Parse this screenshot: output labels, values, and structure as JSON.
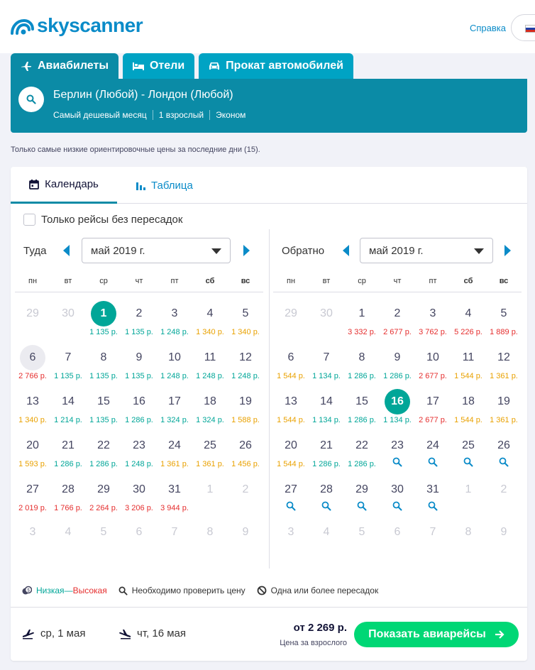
{
  "header": {
    "logo_text": "skyscanner",
    "help_label": "Справка",
    "language": "ru"
  },
  "tabs": [
    {
      "label": "Авиабилеты",
      "icon": "plane-icon",
      "active": true
    },
    {
      "label": "Отели",
      "icon": "bed-icon",
      "active": false
    },
    {
      "label": "Прокат автомобилей",
      "icon": "car-icon",
      "active": false
    }
  ],
  "search": {
    "route": "Берлин (Любой) - Лондон (Любой)",
    "period": "Самый дешевый месяц",
    "passengers": "1 взрослый",
    "cabin": "Эконом"
  },
  "note": "Только самые низкие ориентировочные цены за последние дни (15).",
  "view_tabs": {
    "calendar": "Календарь",
    "table": "Таблица"
  },
  "direct_only": "Только рейсы без пересадок",
  "outbound": {
    "label": "Туда",
    "month": "май 2019 г.",
    "weekdays": [
      "пн",
      "вт",
      "ср",
      "чт",
      "пт",
      "сб",
      "вс"
    ],
    "weeks": [
      [
        {
          "d": "29",
          "m": true
        },
        {
          "d": "30",
          "m": true
        },
        {
          "d": "1",
          "p": "1 135 р.",
          "c": "low",
          "sel": true
        },
        {
          "d": "2",
          "p": "1 135 р.",
          "c": "low"
        },
        {
          "d": "3",
          "p": "1 248 р.",
          "c": "low"
        },
        {
          "d": "4",
          "p": "1 340 р.",
          "c": "mid"
        },
        {
          "d": "5",
          "p": "1 340 р.",
          "c": "mid"
        }
      ],
      [
        {
          "d": "6",
          "p": "2 766 р.",
          "c": "high",
          "today": true
        },
        {
          "d": "7",
          "p": "1 135 р.",
          "c": "low"
        },
        {
          "d": "8",
          "p": "1 135 р.",
          "c": "low"
        },
        {
          "d": "9",
          "p": "1 135 р.",
          "c": "low"
        },
        {
          "d": "10",
          "p": "1 248 р.",
          "c": "low"
        },
        {
          "d": "11",
          "p": "1 248 р.",
          "c": "low"
        },
        {
          "d": "12",
          "p": "1 248 р.",
          "c": "low"
        }
      ],
      [
        {
          "d": "13",
          "p": "1 340 р.",
          "c": "mid"
        },
        {
          "d": "14",
          "p": "1 214 р.",
          "c": "low"
        },
        {
          "d": "15",
          "p": "1 135 р.",
          "c": "low"
        },
        {
          "d": "16",
          "p": "1 286 р.",
          "c": "low"
        },
        {
          "d": "17",
          "p": "1 324 р.",
          "c": "low"
        },
        {
          "d": "18",
          "p": "1 324 р.",
          "c": "low"
        },
        {
          "d": "19",
          "p": "1 588 р.",
          "c": "mid"
        }
      ],
      [
        {
          "d": "20",
          "p": "1 593 р.",
          "c": "mid"
        },
        {
          "d": "21",
          "p": "1 286 р.",
          "c": "low"
        },
        {
          "d": "22",
          "p": "1 286 р.",
          "c": "low"
        },
        {
          "d": "23",
          "p": "1 248 р.",
          "c": "low"
        },
        {
          "d": "24",
          "p": "1 361 р.",
          "c": "mid"
        },
        {
          "d": "25",
          "p": "1 361 р.",
          "c": "mid"
        },
        {
          "d": "26",
          "p": "1 456 р.",
          "c": "mid"
        }
      ],
      [
        {
          "d": "27",
          "p": "2 019 р.",
          "c": "high"
        },
        {
          "d": "28",
          "p": "1 766 р.",
          "c": "high"
        },
        {
          "d": "29",
          "p": "2 264 р.",
          "c": "high"
        },
        {
          "d": "30",
          "p": "3 206 р.",
          "c": "high"
        },
        {
          "d": "31",
          "p": "3 944 р.",
          "c": "high"
        },
        {
          "d": "1",
          "m": true
        },
        {
          "d": "2",
          "m": true
        }
      ],
      [
        {
          "d": "3",
          "m": true
        },
        {
          "d": "4",
          "m": true
        },
        {
          "d": "5",
          "m": true
        },
        {
          "d": "6",
          "m": true
        },
        {
          "d": "7",
          "m": true
        },
        {
          "d": "8",
          "m": true
        },
        {
          "d": "9",
          "m": true
        }
      ]
    ]
  },
  "inbound": {
    "label": "Обратно",
    "month": "май 2019 г.",
    "weekdays": [
      "пн",
      "вт",
      "ср",
      "чт",
      "пт",
      "сб",
      "вс"
    ],
    "weeks": [
      [
        {
          "d": "29",
          "m": true
        },
        {
          "d": "30",
          "m": true
        },
        {
          "d": "1",
          "p": "3 332 р.",
          "c": "high"
        },
        {
          "d": "2",
          "p": "2 677 р.",
          "c": "high"
        },
        {
          "d": "3",
          "p": "3 762 р.",
          "c": "high"
        },
        {
          "d": "4",
          "p": "5 226 р.",
          "c": "high"
        },
        {
          "d": "5",
          "p": "1 889 р.",
          "c": "high"
        }
      ],
      [
        {
          "d": "6",
          "p": "1 544 р.",
          "c": "mid"
        },
        {
          "d": "7",
          "p": "1 134 р.",
          "c": "low"
        },
        {
          "d": "8",
          "p": "1 286 р.",
          "c": "low"
        },
        {
          "d": "9",
          "p": "1 286 р.",
          "c": "low"
        },
        {
          "d": "10",
          "p": "2 677 р.",
          "c": "high"
        },
        {
          "d": "11",
          "p": "1 544 р.",
          "c": "mid"
        },
        {
          "d": "12",
          "p": "1 361 р.",
          "c": "mid"
        }
      ],
      [
        {
          "d": "13",
          "p": "1 544 р.",
          "c": "mid"
        },
        {
          "d": "14",
          "p": "1 134 р.",
          "c": "low"
        },
        {
          "d": "15",
          "p": "1 286 р.",
          "c": "low"
        },
        {
          "d": "16",
          "p": "1 134 р.",
          "c": "low",
          "sel": true
        },
        {
          "d": "17",
          "p": "2 677 р.",
          "c": "high"
        },
        {
          "d": "18",
          "p": "1 544 р.",
          "c": "mid"
        },
        {
          "d": "19",
          "p": "1 361 р.",
          "c": "mid"
        }
      ],
      [
        {
          "d": "20",
          "p": "1 544 р.",
          "c": "mid"
        },
        {
          "d": "21",
          "p": "1 286 р.",
          "c": "low"
        },
        {
          "d": "22",
          "p": "1 286 р.",
          "c": "low"
        },
        {
          "d": "23",
          "s": true
        },
        {
          "d": "24",
          "s": true
        },
        {
          "d": "25",
          "s": true
        },
        {
          "d": "26",
          "s": true
        }
      ],
      [
        {
          "d": "27",
          "s": true
        },
        {
          "d": "28",
          "s": true
        },
        {
          "d": "29",
          "s": true
        },
        {
          "d": "30",
          "s": true
        },
        {
          "d": "31",
          "s": true
        },
        {
          "d": "1",
          "m": true
        },
        {
          "d": "2",
          "m": true
        }
      ],
      [
        {
          "d": "3",
          "m": true
        },
        {
          "d": "4",
          "m": true
        },
        {
          "d": "5",
          "m": true
        },
        {
          "d": "6",
          "m": true
        },
        {
          "d": "7",
          "m": true
        },
        {
          "d": "8",
          "m": true
        },
        {
          "d": "9",
          "m": true
        }
      ]
    ]
  },
  "legend": {
    "low": "Низкая",
    "dash": "—",
    "high": "Высокая",
    "check_price": "Необходимо проверить цену",
    "stops": "Одна или более пересадок"
  },
  "footer": {
    "out_date": "ср, 1 мая",
    "back_date": "чт, 16 мая",
    "price": "от 2 269 р.",
    "price_note": "Цена за взрослого",
    "cta": "Показать авиарейсы"
  },
  "colors": {
    "brand": "#0a8bc8",
    "panel": "#0b8ba6",
    "tab": "#00a3c4",
    "low": "#00a698",
    "mid": "#e9a100",
    "high": "#e52e2e",
    "cta": "#00d775"
  }
}
